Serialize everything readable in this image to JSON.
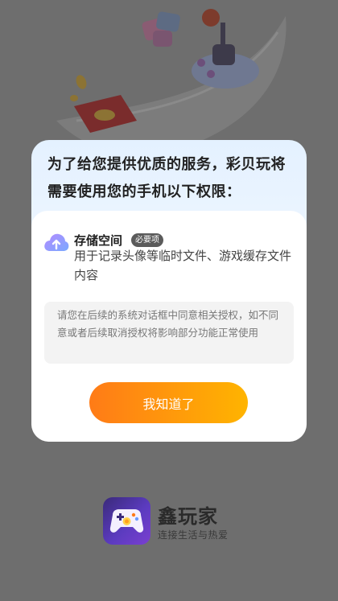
{
  "dialog": {
    "title": "为了给您提供优质的服务，彩贝玩将需要使用您的手机以下权限：",
    "permission": {
      "icon": "cloud-upload-icon",
      "name": "存储空间",
      "badge": "必要项",
      "description": "用于记录头像等临时文件、游戏缓存文件内容"
    },
    "notice": "请您在后续的系统对话框中同意相关授权，如不同意或者后续取消授权将影响部分功能正常使用",
    "confirm_label": "我知道了"
  },
  "brand": {
    "logo_icon": "gamepad-icon",
    "name": "鑫玩家",
    "slogan": "连接生活与热爱"
  },
  "colors": {
    "button_start": "#ff7b17",
    "button_end": "#ffb400",
    "badge_bg": "#5b5b5b",
    "page_bg": "#6e6e6e"
  }
}
